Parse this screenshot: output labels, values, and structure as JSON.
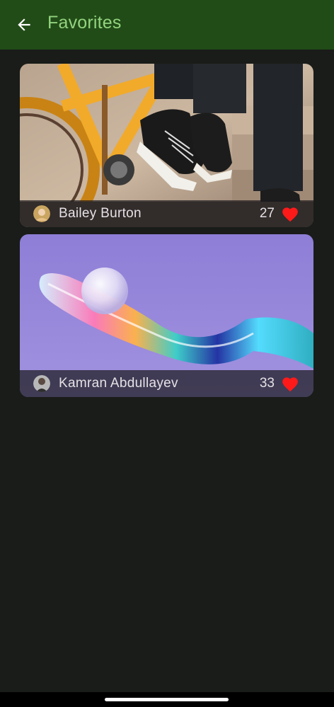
{
  "app_bar": {
    "title": "Favorites",
    "back_icon": "arrow-back-icon",
    "background_color": "#214c17",
    "title_color": "#93d37f"
  },
  "favorites": [
    {
      "author": "Bailey Burton",
      "likes": "27",
      "image": "bicycle-sneakers-photo",
      "avatar": "author-avatar"
    },
    {
      "author": "Kamran Abdullayev",
      "likes": "33",
      "image": "abstract-glass-wave-photo",
      "avatar": "author-avatar"
    }
  ],
  "heart_color": "#ff1a1a",
  "background_color": "#191c19"
}
